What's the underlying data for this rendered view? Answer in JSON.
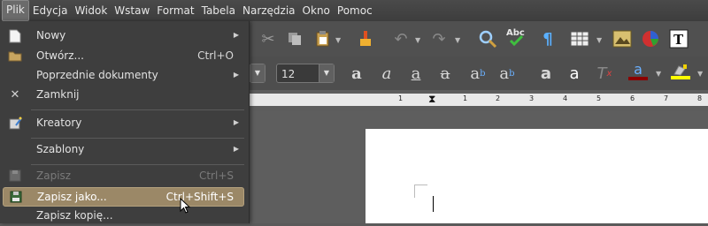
{
  "menubar": {
    "items": [
      {
        "label": "Plik",
        "active": true
      },
      {
        "label": "Edycja"
      },
      {
        "label": "Widok"
      },
      {
        "label": "Wstaw"
      },
      {
        "label": "Format"
      },
      {
        "label": "Tabela"
      },
      {
        "label": "Narzędzia"
      },
      {
        "label": "Okno"
      },
      {
        "label": "Pomoc"
      }
    ]
  },
  "file_menu": {
    "new": {
      "label": "Nowy"
    },
    "open": {
      "label": "Otwórz...",
      "shortcut": "Ctrl+O"
    },
    "recent": {
      "label": "Poprzednie dokumenty"
    },
    "close": {
      "label": "Zamknij"
    },
    "wizards": {
      "label": "Kreatory"
    },
    "templates": {
      "label": "Szablony"
    },
    "save": {
      "label": "Zapisz",
      "shortcut": "Ctrl+S",
      "disabled": true
    },
    "save_as": {
      "label": "Zapisz jako...",
      "shortcut": "Ctrl+Shift+S",
      "highlighted": true
    },
    "save_copy": {
      "label": "Zapisz kopię..."
    }
  },
  "formatting": {
    "font_size": "12"
  },
  "ruler": {
    "numbers": [
      "1",
      "1",
      "2",
      "3",
      "4",
      "5",
      "6",
      "7",
      "8"
    ]
  },
  "colors": {
    "menu_bg": "#3e3e3e",
    "highlight": "#9b8867",
    "font_color_bar": "#8b0000",
    "highlight_color_bar": "#ffff00"
  }
}
